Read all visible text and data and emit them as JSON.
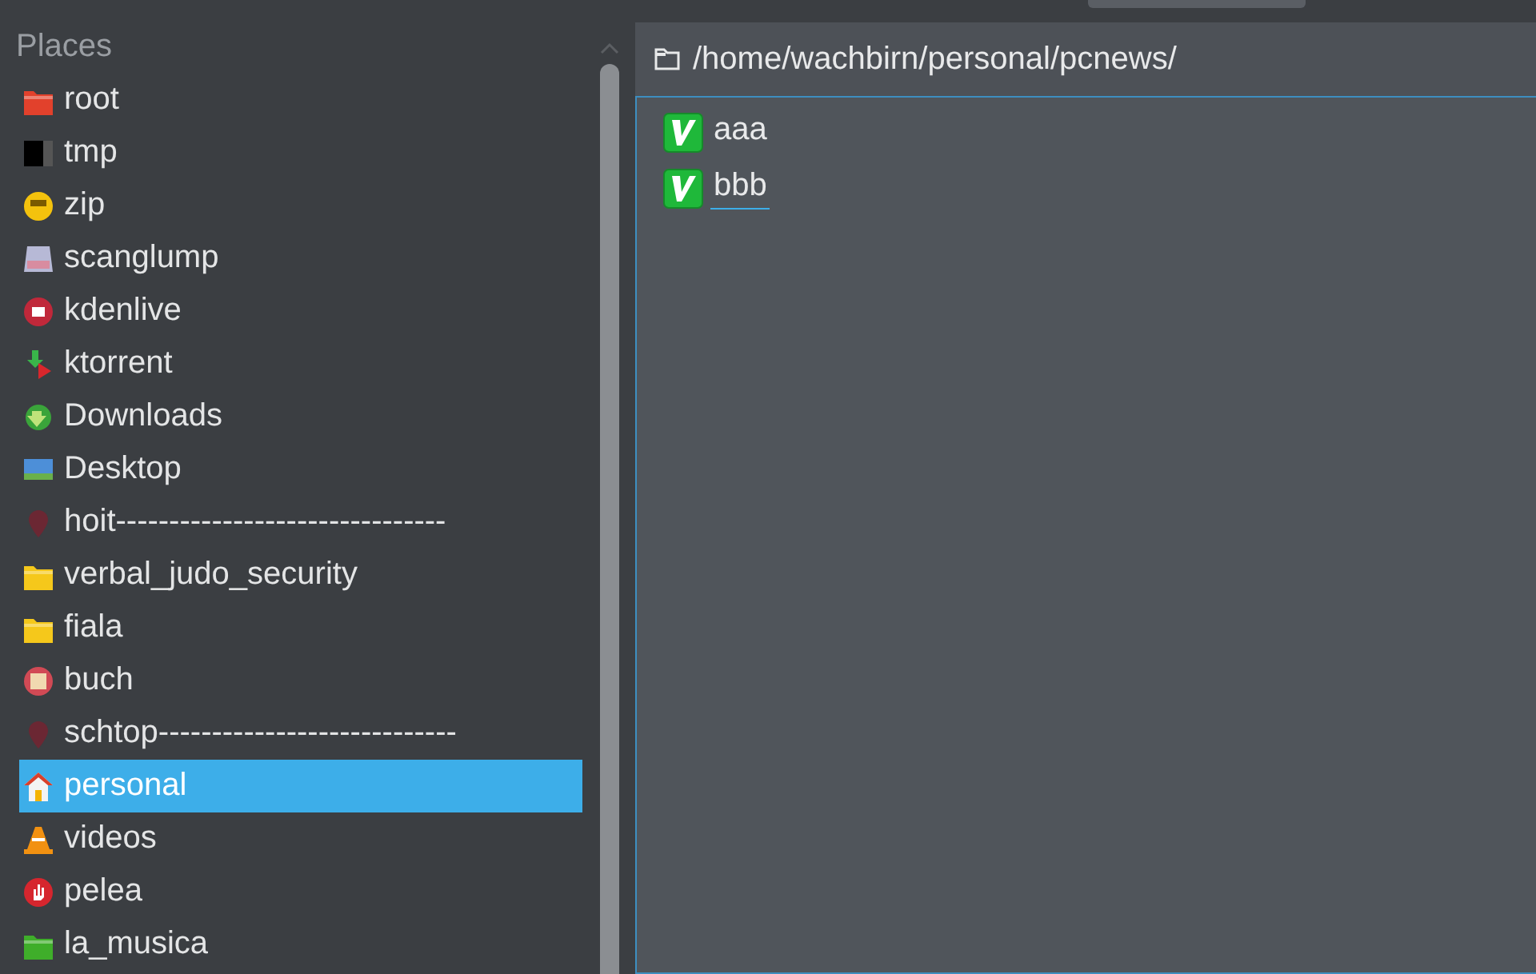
{
  "places": {
    "title": "Places",
    "items": [
      {
        "label": "root",
        "kind": "folder",
        "color": "#e2412c",
        "selected": false
      },
      {
        "label": "tmp",
        "kind": "drive",
        "selected": false
      },
      {
        "label": "zip",
        "kind": "badge",
        "selected": false
      },
      {
        "label": "scanglump",
        "kind": "scanner",
        "selected": false
      },
      {
        "label": "kdenlive",
        "kind": "record",
        "selected": false
      },
      {
        "label": "ktorrent",
        "kind": "torrent",
        "selected": false
      },
      {
        "label": "Downloads",
        "kind": "download",
        "selected": false
      },
      {
        "label": "Desktop",
        "kind": "desktop",
        "selected": false
      },
      {
        "label": "hoit-------------------------------",
        "kind": "pin",
        "selected": false
      },
      {
        "label": "verbal_judo_security",
        "kind": "folder",
        "color": "#f5c81b",
        "selected": false
      },
      {
        "label": "fiala",
        "kind": "folder",
        "color": "#f5c81b",
        "selected": false
      },
      {
        "label": "buch",
        "kind": "book",
        "selected": false
      },
      {
        "label": "schtop----------------------------",
        "kind": "pin",
        "selected": false
      },
      {
        "label": "personal",
        "kind": "home",
        "selected": true
      },
      {
        "label": "videos",
        "kind": "cone",
        "selected": false
      },
      {
        "label": "pelea",
        "kind": "hand",
        "selected": false
      },
      {
        "label": "la_musica",
        "kind": "folder",
        "color": "#3fae2a",
        "selected": false
      }
    ]
  },
  "path": "/home/wachbirn/personal/pcnews/",
  "files": [
    {
      "name": "aaa",
      "focused": false
    },
    {
      "name": "bbb",
      "focused": true
    }
  ]
}
